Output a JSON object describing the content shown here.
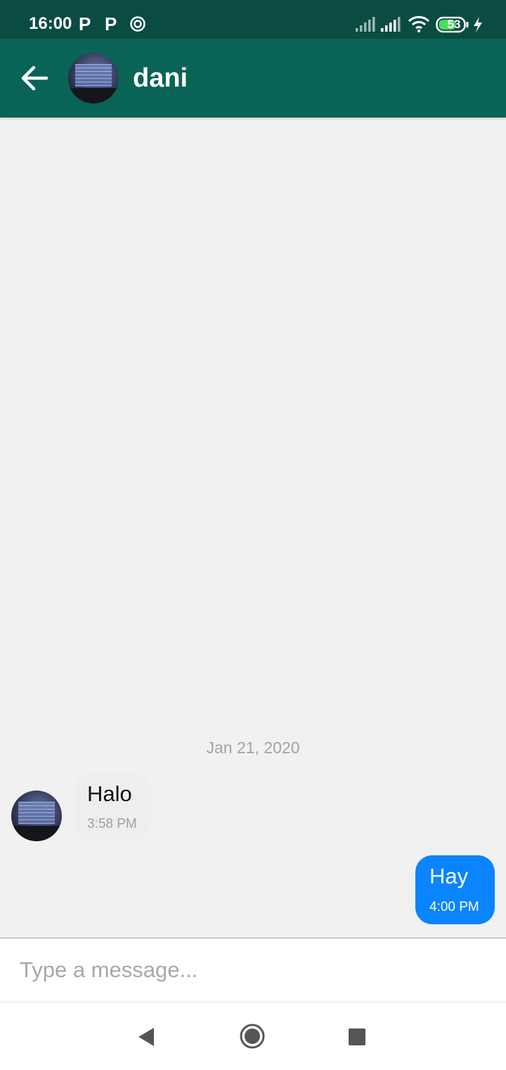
{
  "status_bar": {
    "time": "16:00",
    "notification_icons": [
      "p",
      "p",
      "ring"
    ],
    "notification_labels": [
      "P",
      "P"
    ],
    "signal_icons": [
      "signal-1-icon",
      "signal-2-icon"
    ],
    "wifi_icon": "wifi-icon",
    "battery_level": "53",
    "charging": true
  },
  "header": {
    "back_icon": "arrow-left-icon",
    "contact_name": "dani",
    "background_color": "#0a6357"
  },
  "conversation": {
    "date_separator": "Jan 21, 2020",
    "messages": [
      {
        "direction": "incoming",
        "text": "Halo",
        "time": "3:58 PM",
        "bubble_color": "#eeeeee"
      },
      {
        "direction": "outgoing",
        "text": "Hay",
        "time": "4:00 PM",
        "bubble_color": "#0a84ff"
      }
    ]
  },
  "composer": {
    "placeholder": "Type a message...",
    "value": ""
  },
  "nav_bar": {
    "buttons": [
      "back-triangle-icon",
      "home-circle-icon",
      "recents-square-icon"
    ]
  }
}
